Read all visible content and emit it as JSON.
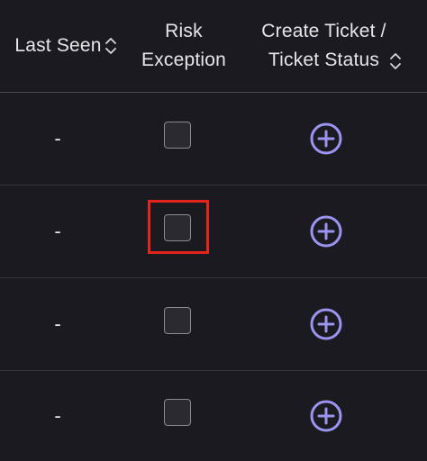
{
  "columns": {
    "last_seen": "Last Seen",
    "risk_exception_line1": "Risk",
    "risk_exception_line2": "Exception",
    "create_ticket_line1": "Create Ticket /",
    "create_ticket_line2": "Ticket Status"
  },
  "rows": [
    {
      "last_seen": "-",
      "risk_exception_checked": false
    },
    {
      "last_seen": "-",
      "risk_exception_checked": false
    },
    {
      "last_seen": "-",
      "risk_exception_checked": false
    },
    {
      "last_seen": "-",
      "risk_exception_checked": false
    }
  ],
  "icons": {
    "sort": "sort-updown-icon",
    "create_ticket": "plus-circle-icon"
  },
  "colors": {
    "background": "#1a1a20",
    "accent": "#9b94f0",
    "highlight": "#e3261c"
  }
}
